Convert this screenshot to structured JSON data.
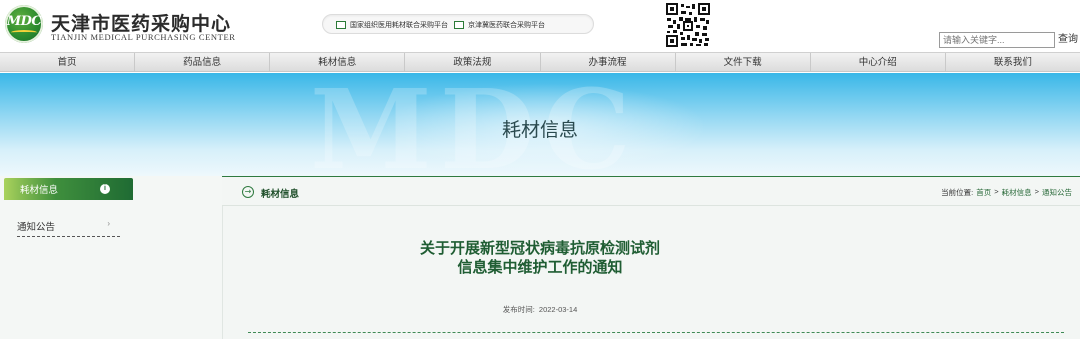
{
  "logo": {
    "badge_text": "MDC",
    "name_cn": "天津市医药采购中心",
    "name_en": "TIANJIN MEDICAL PURCHASING CENTER"
  },
  "platforms": [
    {
      "label": "国家组织医用耗材联合采购平台"
    },
    {
      "label": "京津冀医药联合采购平台"
    }
  ],
  "search": {
    "placeholder": "请输入关键字...",
    "button_label": "查询"
  },
  "nav": [
    "首页",
    "药品信息",
    "耗材信息",
    "政策法规",
    "办事流程",
    "文件下载",
    "中心介绍",
    "联系我们"
  ],
  "banner": {
    "title": "耗材信息",
    "watermark": "MDC"
  },
  "sidebar": {
    "header": "耗材信息",
    "items": [
      {
        "label": "通知公告"
      }
    ]
  },
  "main": {
    "section_title": "耗材信息",
    "breadcrumb": {
      "prefix": "当前位置:",
      "items": [
        "首页",
        ">",
        "耗材信息",
        ">",
        "通知公告"
      ]
    }
  },
  "article": {
    "title_line1": "关于开展新型冠状病毒抗原检测试剂",
    "title_line2": "信息集中维护工作的通知",
    "date_label": "发布时间:",
    "date": "2022-03-14"
  },
  "colors": {
    "brand_green": "#1f6b33",
    "title_green": "#1f5d33",
    "banner_blue": "#39b7e8"
  }
}
